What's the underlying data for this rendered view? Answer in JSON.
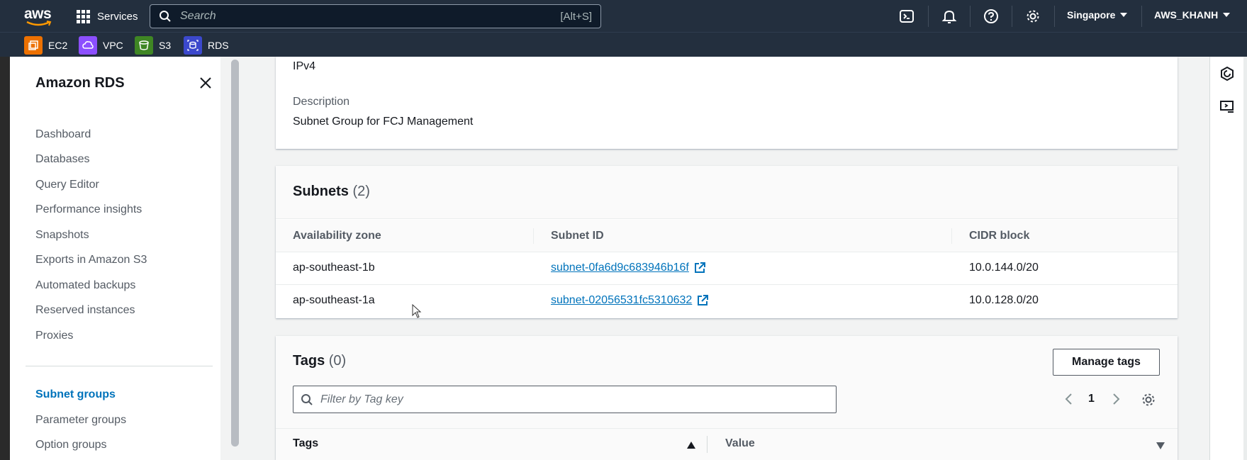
{
  "topbar": {
    "logo_text": "aws",
    "services_label": "Services",
    "search_placeholder": "Search",
    "search_shortcut": "[Alt+S]",
    "region": "Singapore",
    "account": "AWS_KHANH",
    "icons": [
      "cloudshell-icon",
      "bell-icon",
      "help-icon",
      "settings-icon"
    ]
  },
  "favorites": [
    {
      "label": "EC2",
      "color": "#ed7100",
      "icon": "ec2-icon"
    },
    {
      "label": "VPC",
      "color": "#8c4fff",
      "icon": "vpc-icon"
    },
    {
      "label": "S3",
      "color": "#3f8624",
      "icon": "s3-icon"
    },
    {
      "label": "RDS",
      "color": "#3b48cc",
      "icon": "rds-icon"
    }
  ],
  "sidenav": {
    "title": "Amazon RDS",
    "items": [
      {
        "label": "Dashboard"
      },
      {
        "label": "Databases"
      },
      {
        "label": "Query Editor"
      },
      {
        "label": "Performance insights"
      },
      {
        "label": "Snapshots"
      },
      {
        "label": "Exports in Amazon S3"
      },
      {
        "label": "Automated backups"
      },
      {
        "label": "Reserved instances"
      },
      {
        "label": "Proxies"
      }
    ],
    "items2": [
      {
        "label": "Subnet groups",
        "active": true
      },
      {
        "label": "Parameter groups"
      },
      {
        "label": "Option groups"
      }
    ]
  },
  "details": {
    "network_type_value": "IPv4",
    "description_label": "Description",
    "description_value": "Subnet Group for FCJ Management"
  },
  "subnets": {
    "title": "Subnets",
    "count": "(2)",
    "columns": [
      "Availability zone",
      "Subnet ID",
      "CIDR block"
    ],
    "rows": [
      {
        "az": "ap-southeast-1b",
        "subnet_id": "subnet-0fa6d9c683946b16f",
        "cidr": "10.0.144.0/20"
      },
      {
        "az": "ap-southeast-1a",
        "subnet_id": "subnet-02056531fc5310632",
        "cidr": "10.0.128.0/20"
      }
    ]
  },
  "tags": {
    "title": "Tags",
    "count": "(0)",
    "manage_button": "Manage tags",
    "filter_placeholder": "Filter by Tag key",
    "page_number": "1",
    "columns": [
      "Tags",
      "Value"
    ]
  }
}
